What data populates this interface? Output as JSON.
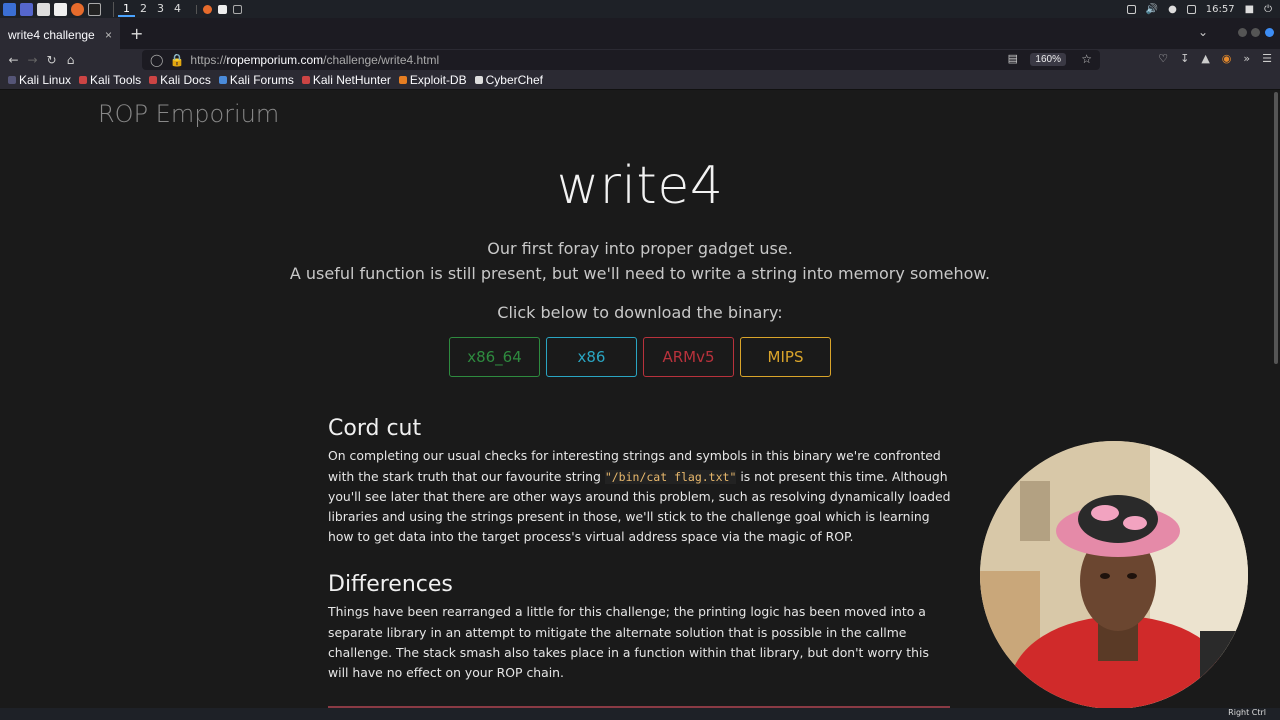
{
  "taskbar": {
    "workspaces": [
      "1",
      "2",
      "3",
      "4"
    ],
    "clock": "16:57"
  },
  "browser": {
    "tab_title": "write4 challenge",
    "tab_close": "×",
    "new_tab": "+",
    "url_prefix": "https://",
    "url_host": "ropemporium.com",
    "url_path": "/challenge/write4.html",
    "zoom": "160%",
    "bookmarks": [
      "Kali Linux",
      "Kali Tools",
      "Kali Docs",
      "Kali Forums",
      "Kali NetHunter",
      "Exploit-DB",
      "CyberChef"
    ]
  },
  "page": {
    "brand": "ROP Emporium",
    "title": "write4",
    "subtitle_1": "Our first foray into proper gadget use.",
    "subtitle_2": "A useful function is still present, but we'll need to write a string into memory somehow.",
    "download_prompt": "Click below to download the binary:",
    "downloads": [
      {
        "label": "x86_64",
        "color": "#2e8b3f"
      },
      {
        "label": "x86",
        "color": "#2aa5c2"
      },
      {
        "label": "ARMv5",
        "color": "#b8323c"
      },
      {
        "label": "MIPS",
        "color": "#d9a42a"
      }
    ],
    "section1": {
      "heading": "Cord cut",
      "text_a": "On completing our usual checks for interesting strings and symbols in this binary we're confronted with the stark truth that our favourite string ",
      "code": "\"/bin/cat flag.txt\"",
      "text_b": " is not present this time. Although you'll see later that there are other ways around this problem, such as resolving dynamically loaded libraries and using the strings present in those, we'll stick to the challenge goal which is learning how to get data into the target process's virtual address space via the magic of ROP."
    },
    "section2": {
      "heading": "Differences",
      "text": "Things have been rearranged a little for this challenge; the printing logic has been moved into a separate library in an attempt to mitigate the alternate solution that is possible in the callme challenge. The stack smash also takes place in a function within that library, but don't worry this will have no effect on your ROP chain."
    }
  },
  "statusbar": {
    "right_label": "Right Ctrl"
  }
}
